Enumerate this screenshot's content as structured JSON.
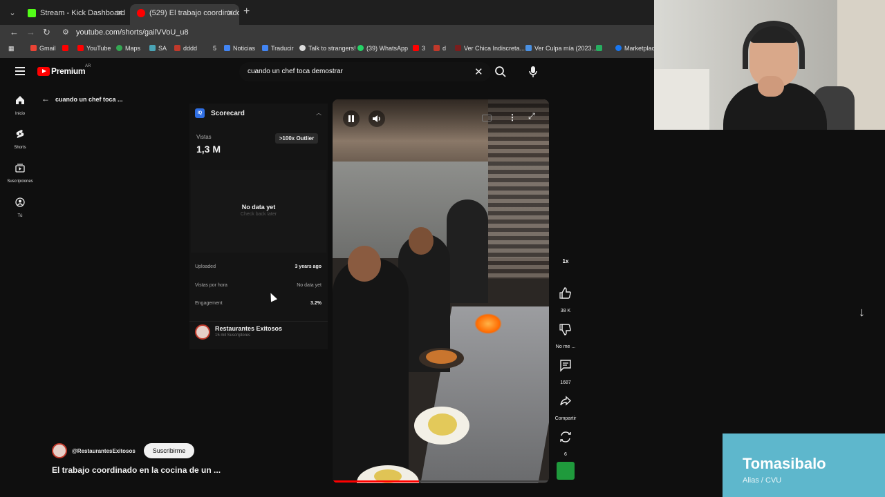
{
  "browser": {
    "tabs": [
      {
        "title": "Stream - Kick Dashboard",
        "color": "#53fc18"
      },
      {
        "title": "(529) El trabajo coordinado",
        "color": "#ff0000"
      }
    ],
    "url": "youtube.com/shorts/gailVVoU_u8",
    "bookmarks": [
      {
        "label": "Gmail",
        "color": "#ea4335"
      },
      {
        "label": "",
        "color": "#ff0000"
      },
      {
        "label": "YouTube",
        "color": "#ff0000"
      },
      {
        "label": "Maps",
        "color": "#34a853"
      },
      {
        "label": "SA",
        "color": "#4aa3b5"
      },
      {
        "label": "dddd",
        "color": "#c0392b"
      },
      {
        "label": "5",
        "color": "#3a3a3a"
      },
      {
        "label": "Noticias",
        "color": "#4285f4"
      },
      {
        "label": "Traducir",
        "color": "#4285f4"
      },
      {
        "label": "Talk to strangers!",
        "color": "#dddddd"
      },
      {
        "label": "(39) WhatsApp",
        "color": "#25d366"
      },
      {
        "label": "3",
        "color": "#ff0000"
      },
      {
        "label": "d",
        "color": "#c0392b"
      },
      {
        "label": "Ver Chica Indiscreta...",
        "color": "#7a1e1e"
      },
      {
        "label": "Ver Culpa mía (2023...",
        "color": "#4a90e2"
      },
      {
        "label": "",
        "color": "#27ae60"
      },
      {
        "label": "Marketplace",
        "color": "#1877f2"
      }
    ]
  },
  "youtube": {
    "logo_text": "Premium",
    "logo_region": "AR",
    "search_query": "cuando un chef toca demostrar",
    "rail": [
      {
        "label": "Inicio",
        "icon": "home-icon"
      },
      {
        "label": "Shorts",
        "icon": "shorts-icon"
      },
      {
        "label": "Suscripciones",
        "icon": "subscriptions-icon"
      },
      {
        "label": "Tú",
        "icon": "you-icon"
      }
    ],
    "back_text": "cuando un chef toca ..."
  },
  "scorecard": {
    "logo": "IQ",
    "title": "Scorecard",
    "views_label": "Vistas",
    "views_value": "1,3 M",
    "outlier_badge": ">100x Outlier",
    "nodata_title": "No data yet",
    "nodata_sub": "Check back later",
    "stats": [
      {
        "label": "Uploaded",
        "value": "3 years ago"
      },
      {
        "label": "Vistas por hora",
        "value": "No data yet"
      },
      {
        "label": "Engagement",
        "value": "3.2%"
      }
    ],
    "channel_name": "Restaurantes Exitosos",
    "channel_subs": "15 mil Suscriptores"
  },
  "actions": {
    "speed": "1x",
    "likes": "38 K",
    "dislike_label": "No me ...",
    "comments": "1687",
    "share_label": "Compartir",
    "remix_count": "6"
  },
  "video_progress": 0.4,
  "shorts_meta": {
    "handle": "@RestaurantesExitosos",
    "subscribe_label": "Suscribirme",
    "title": "El trabajo coordinado en la cocina de un ..."
  },
  "overlay": {
    "name": "Tomasibalo",
    "sub": "Alias / CVU"
  }
}
